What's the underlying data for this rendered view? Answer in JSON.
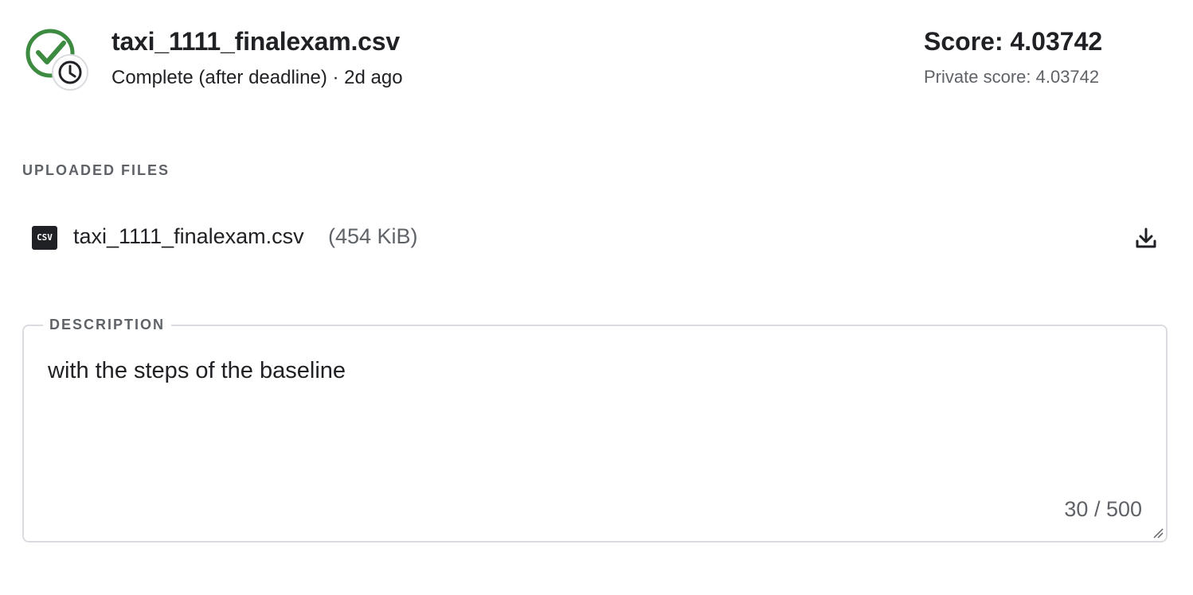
{
  "submission": {
    "file_name": "taxi_1111_finalexam.csv",
    "status": "Complete (after deadline) · 2d ago",
    "score": "Score: 4.03742",
    "private_score": "Private score: 4.03742"
  },
  "uploaded_files": {
    "label": "UPLOADED FILES",
    "files": [
      {
        "icon": "csv-file-icon",
        "icon_text": "CSV",
        "name": "taxi_1111_finalexam.csv",
        "size": "(454 KiB)"
      }
    ]
  },
  "description": {
    "label": "DESCRIPTION",
    "value": "with the steps of the baseline",
    "char_count": "30 / 500"
  },
  "colors": {
    "success_green": "#3d8b40",
    "text_primary": "#202124",
    "text_secondary": "#5f6368",
    "border": "#dadce0"
  }
}
